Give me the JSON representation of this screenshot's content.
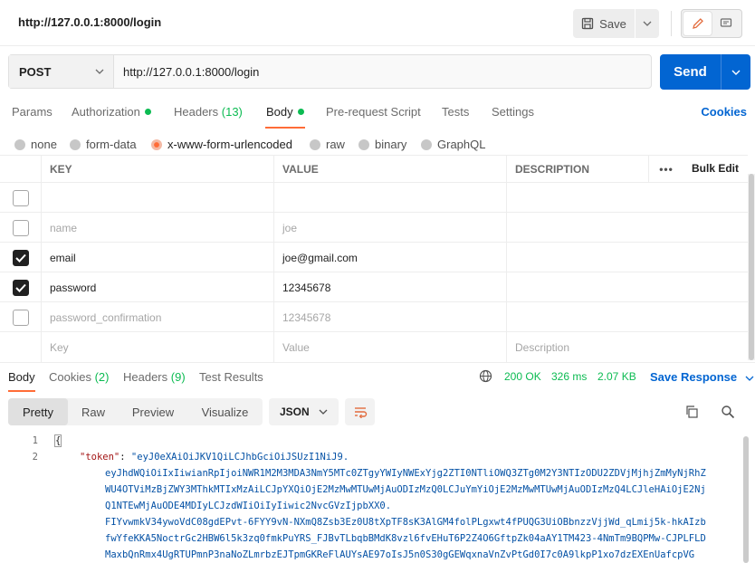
{
  "top": {
    "title": "http://127.0.0.1:8000/login",
    "save_label": "Save"
  },
  "request": {
    "method": "POST",
    "url": "http://127.0.0.1:8000/login",
    "send_label": "Send"
  },
  "req_tabs": {
    "params": "Params",
    "authorization": "Authorization",
    "headers": "Headers",
    "headers_count": "(13)",
    "body": "Body",
    "prerequest": "Pre-request Script",
    "tests": "Tests",
    "settings": "Settings",
    "cookies": "Cookies"
  },
  "body_types": [
    "none",
    "form-data",
    "x-www-form-urlencoded",
    "raw",
    "binary",
    "GraphQL"
  ],
  "table": {
    "headers": {
      "key": "KEY",
      "value": "VALUE",
      "description": "DESCRIPTION",
      "more": "•••",
      "bulk_edit": "Bulk Edit"
    },
    "rows": [
      {
        "checked": false,
        "key": "",
        "value": "",
        "enabled": true
      },
      {
        "checked": false,
        "key": "name",
        "value": "joe",
        "enabled": false
      },
      {
        "checked": true,
        "key": "email",
        "value": "joe@gmail.com",
        "enabled": true
      },
      {
        "checked": true,
        "key": "password",
        "value": "12345678",
        "enabled": true
      },
      {
        "checked": false,
        "key": "password_confirmation",
        "value": "12345678",
        "enabled": false
      }
    ],
    "placeholder": {
      "key": "Key",
      "value": "Value",
      "description": "Description"
    }
  },
  "res_tabs": {
    "body": "Body",
    "cookies": "Cookies",
    "cookies_count": "(2)",
    "headers": "Headers",
    "headers_count": "(9)",
    "test_results": "Test Results",
    "status": "200 OK",
    "time": "326 ms",
    "size": "2.07 KB",
    "save_response": "Save Response"
  },
  "view": {
    "modes": [
      "Pretty",
      "Raw",
      "Preview",
      "Visualize"
    ],
    "format": "JSON"
  },
  "code": {
    "line_numbers": [
      "1",
      "2"
    ],
    "open_brace": "{",
    "token_key": "\"token\"",
    "token_sep": ": ",
    "token_first": "\"eyJ0eXAiOiJKV1QiLCJhbGciOiJSUzI1NiJ9.",
    "token_lines": [
      "eyJhdWQiOiIxIiwianRpIjoiNWR1M2M3MDA3NmY5MTc0ZTgyYWIyNWExYjg2ZTI0NTliOWQ3ZTg0M2Y3NTIzODU2ZDVjMjhjZmMyNjRhZ",
      "WU4OTViMzBjZWY3MThkMTIxMzAiLCJpYXQiOjE2MzMwMTUwMjAuODIzMzQ0LCJuYmYiOjE2MzMwMTUwMjAuODIzMzQ4LCJleHAiOjE2Nj",
      "Q1NTEwMjAuODE4MDIyLCJzdWIiOiIyIiwic2NvcGVzIjpbXX0.",
      "FIYvwmkV34ywoVdC08gdEPvt-6FYY9vN-NXmQ8Zsb3Ez0U8tXpTF8sK3AlGM4folPLgxwt4fPUQG3UiOBbnzzVjjWd_qLmij5k-hkAIzb",
      "fwYfeKKA5NoctrGc2HBW6l5k3zq0fmkPuYRS_FJBvTLbqbBMdK8vzl6fvEHuT6P2Z4O6GftpZk04aAY1TM423-4NmTm9BQPMw-CJPLFLD",
      "MaxbQnRmx4UgRTUPmnP3naNoZLmrbzEJTpmGKReFlAUYsAE97oIsJ5n0S30gGEWqxnaVnZvPtGd0I7c0A9lkpP1xo7dzEXEnUafcpVG"
    ]
  }
}
